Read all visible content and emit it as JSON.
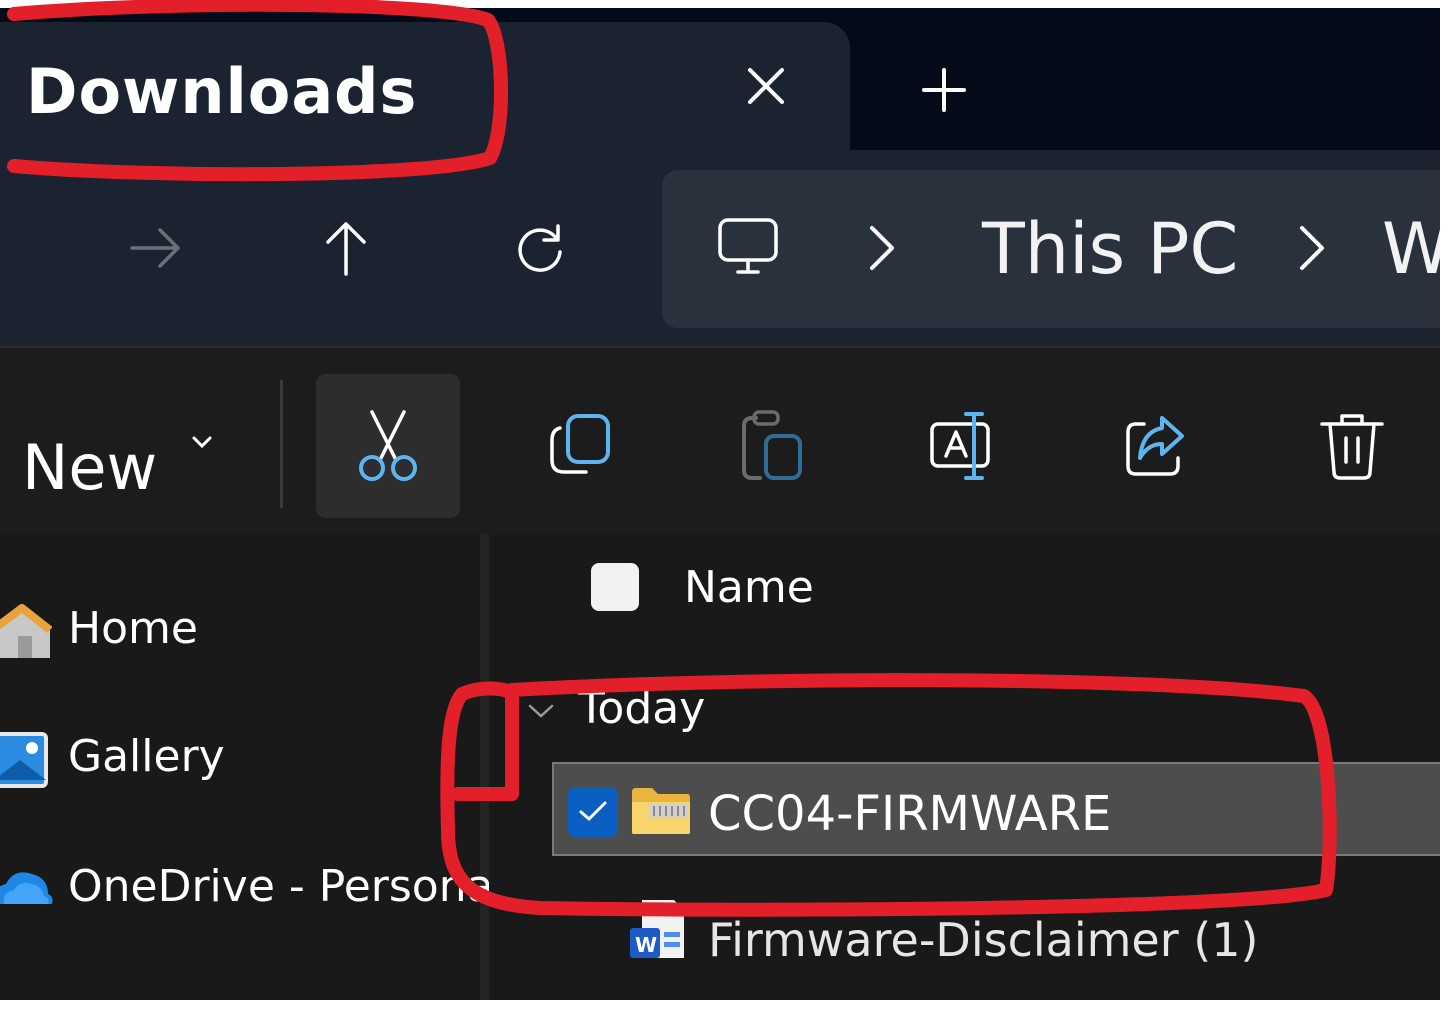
{
  "window": {
    "tab": {
      "title": "Downloads",
      "close_icon": "close-icon",
      "new_tab_icon": "plus-icon"
    }
  },
  "navigation": {
    "forward_icon": "arrow-right-icon",
    "up_icon": "arrow-up-icon",
    "refresh_icon": "refresh-icon",
    "breadcrumb": {
      "root_icon": "monitor-icon",
      "items": [
        "This PC",
        "W"
      ]
    }
  },
  "toolbar": {
    "new_label": "New",
    "buttons": [
      {
        "name": "cut",
        "icon": "scissors-icon",
        "active": true
      },
      {
        "name": "copy",
        "icon": "copy-icon",
        "active": false
      },
      {
        "name": "paste",
        "icon": "clipboard-icon",
        "active": false
      },
      {
        "name": "rename",
        "icon": "rename-icon",
        "active": false
      },
      {
        "name": "share",
        "icon": "share-icon",
        "active": false
      },
      {
        "name": "delete",
        "icon": "trash-icon",
        "active": false
      }
    ]
  },
  "sidebar": {
    "items": [
      {
        "label": "Home",
        "icon": "home-icon"
      },
      {
        "label": "Gallery",
        "icon": "gallery-icon"
      },
      {
        "label": "OneDrive - Persona",
        "icon": "onedrive-icon"
      }
    ]
  },
  "file_list": {
    "columns": [
      "Name"
    ],
    "groups": [
      {
        "label": "Today",
        "rows": [
          {
            "name": "CC04-FIRMWARE",
            "icon": "zip-folder-icon",
            "selected": true
          },
          {
            "name": "Firmware-Disclaimer (1)",
            "icon": "word-document-icon",
            "selected": false
          }
        ]
      }
    ]
  },
  "colors": {
    "titlebar_bg": "#030a18",
    "tab_bg": "#1c2330",
    "address_bg": "#29313d",
    "content_bg": "#191919",
    "selection_bg": "#4d4d4d",
    "checkbox_accent": "#0a5fc0",
    "annotation": "#e3202a"
  }
}
